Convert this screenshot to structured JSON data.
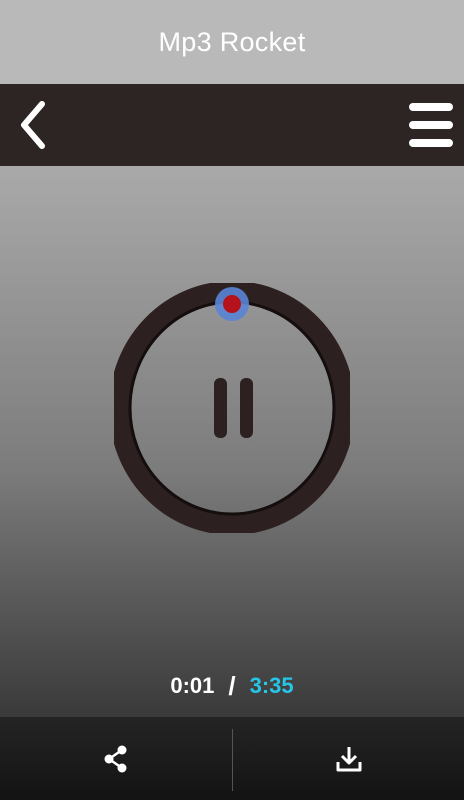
{
  "app": {
    "title": "Mp3 Rocket"
  },
  "nav": {
    "back_icon": "chevron-left-icon",
    "menu_icon": "hamburger-menu-icon"
  },
  "player": {
    "state_icon": "pause-icon",
    "elapsed": "0:01",
    "separator": "/",
    "total": "3:35",
    "progress_fraction": 0.005
  },
  "actions": {
    "share_icon": "share-icon",
    "download_icon": "download-icon"
  },
  "colors": {
    "title_bar": "#b9b9b9",
    "nav_bar": "#2d2424",
    "dial": "#2d2020",
    "accent_time": "#26c6e8",
    "progress_knob_outer": "#5a84d6",
    "progress_knob_inner": "#b5121b"
  }
}
